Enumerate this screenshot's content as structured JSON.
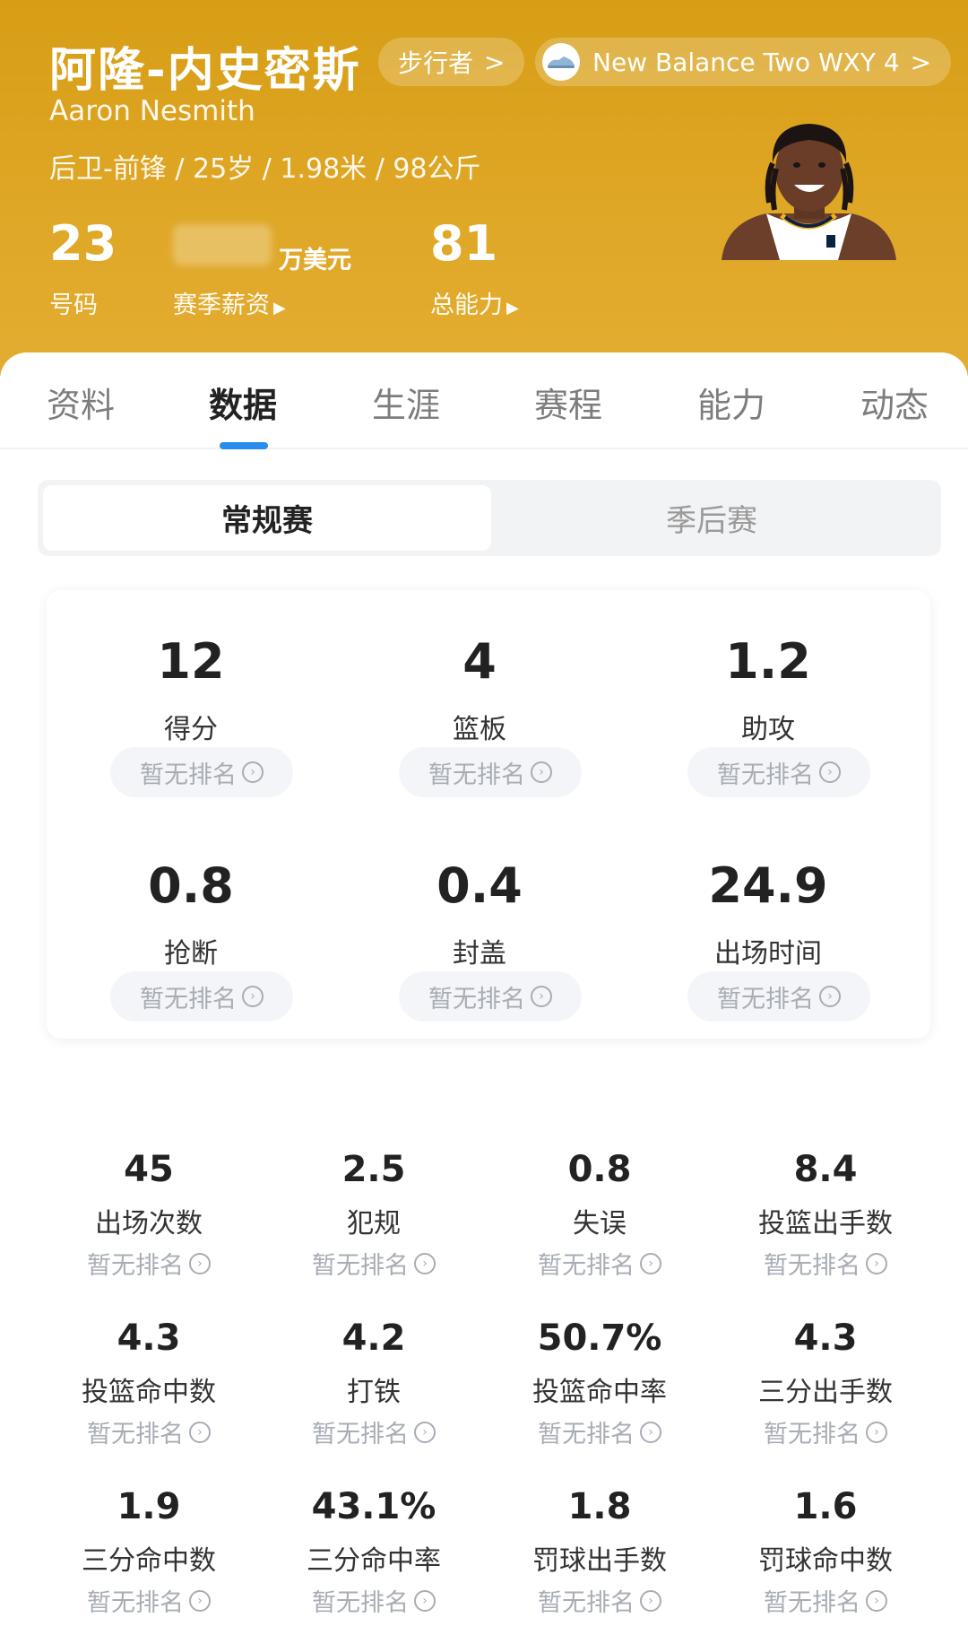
{
  "player": {
    "name_cn": "阿隆-内史密斯",
    "name_en": "Aaron Nesmith",
    "meta": "后卫-前锋 / 25岁 / 1.98米 / 98公斤",
    "walker_label": "步行者",
    "shoe_label": "New Balance Two WXY 4",
    "chevron": ">",
    "number": "23",
    "number_label": "号码",
    "salary_unit": "万美元",
    "salary_label": "赛季薪资",
    "overall": "81",
    "overall_label": "总能力"
  },
  "tabs": [
    {
      "label": "资料",
      "active": false
    },
    {
      "label": "数据",
      "active": true
    },
    {
      "label": "生涯",
      "active": false
    },
    {
      "label": "赛程",
      "active": false
    },
    {
      "label": "能力",
      "active": false
    },
    {
      "label": "动态",
      "active": false
    }
  ],
  "season_toggle": {
    "regular": "常规赛",
    "playoffs": "季后赛"
  },
  "rank_text": "暂无排名",
  "main_stats": [
    {
      "value": "12",
      "label": "得分"
    },
    {
      "value": "4",
      "label": "篮板"
    },
    {
      "value": "1.2",
      "label": "助攻"
    },
    {
      "value": "0.8",
      "label": "抢断"
    },
    {
      "value": "0.4",
      "label": "封盖"
    },
    {
      "value": "24.9",
      "label": "出场时间"
    }
  ],
  "secondary_stats": [
    {
      "value": "45",
      "label": "出场次数"
    },
    {
      "value": "2.5",
      "label": "犯规"
    },
    {
      "value": "0.8",
      "label": "失误"
    },
    {
      "value": "8.4",
      "label": "投篮出手数"
    },
    {
      "value": "4.3",
      "label": "投篮命中数"
    },
    {
      "value": "4.2",
      "label": "打铁"
    },
    {
      "value": "50.7%",
      "label": "投篮命中率"
    },
    {
      "value": "4.3",
      "label": "三分出手数"
    },
    {
      "value": "1.9",
      "label": "三分命中数"
    },
    {
      "value": "43.1%",
      "label": "三分命中率"
    },
    {
      "value": "1.8",
      "label": "罚球出手数"
    },
    {
      "value": "1.6",
      "label": "罚球命中数"
    }
  ],
  "colors": {
    "header_gold": "#dba21f",
    "accent_blue": "#2b8cf0",
    "muted_gray": "#a8adb5"
  }
}
